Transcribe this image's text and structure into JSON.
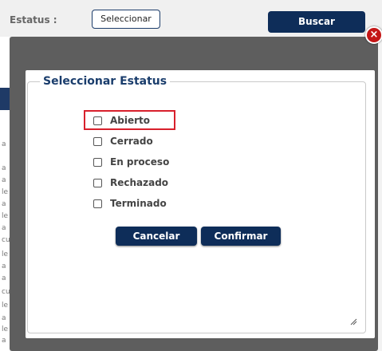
{
  "background": {
    "status_label": "Estatus :",
    "select_button": "Seleccionar",
    "search_button": "Buscar",
    "strip_letters": [
      "a",
      "a",
      "a",
      "le",
      "a",
      "le",
      "a",
      "cu",
      "le",
      "a",
      "a",
      "cu",
      "le",
      "a",
      "le",
      "a"
    ]
  },
  "dialog": {
    "title": "Seleccionar Estatus",
    "close_icon": "close-icon",
    "options": [
      {
        "label": "Abierto",
        "checked": false
      },
      {
        "label": "Cerrado",
        "checked": false
      },
      {
        "label": "En proceso",
        "checked": false
      },
      {
        "label": "Rechazado",
        "checked": false
      },
      {
        "label": "Terminado",
        "checked": false
      }
    ],
    "cancel_label": "Cancelar",
    "confirm_label": "Confirmar"
  },
  "colors": {
    "primary": "#0e2d59",
    "title": "#1a3d6c",
    "highlight": "#d8202c",
    "close": "#c41616"
  }
}
